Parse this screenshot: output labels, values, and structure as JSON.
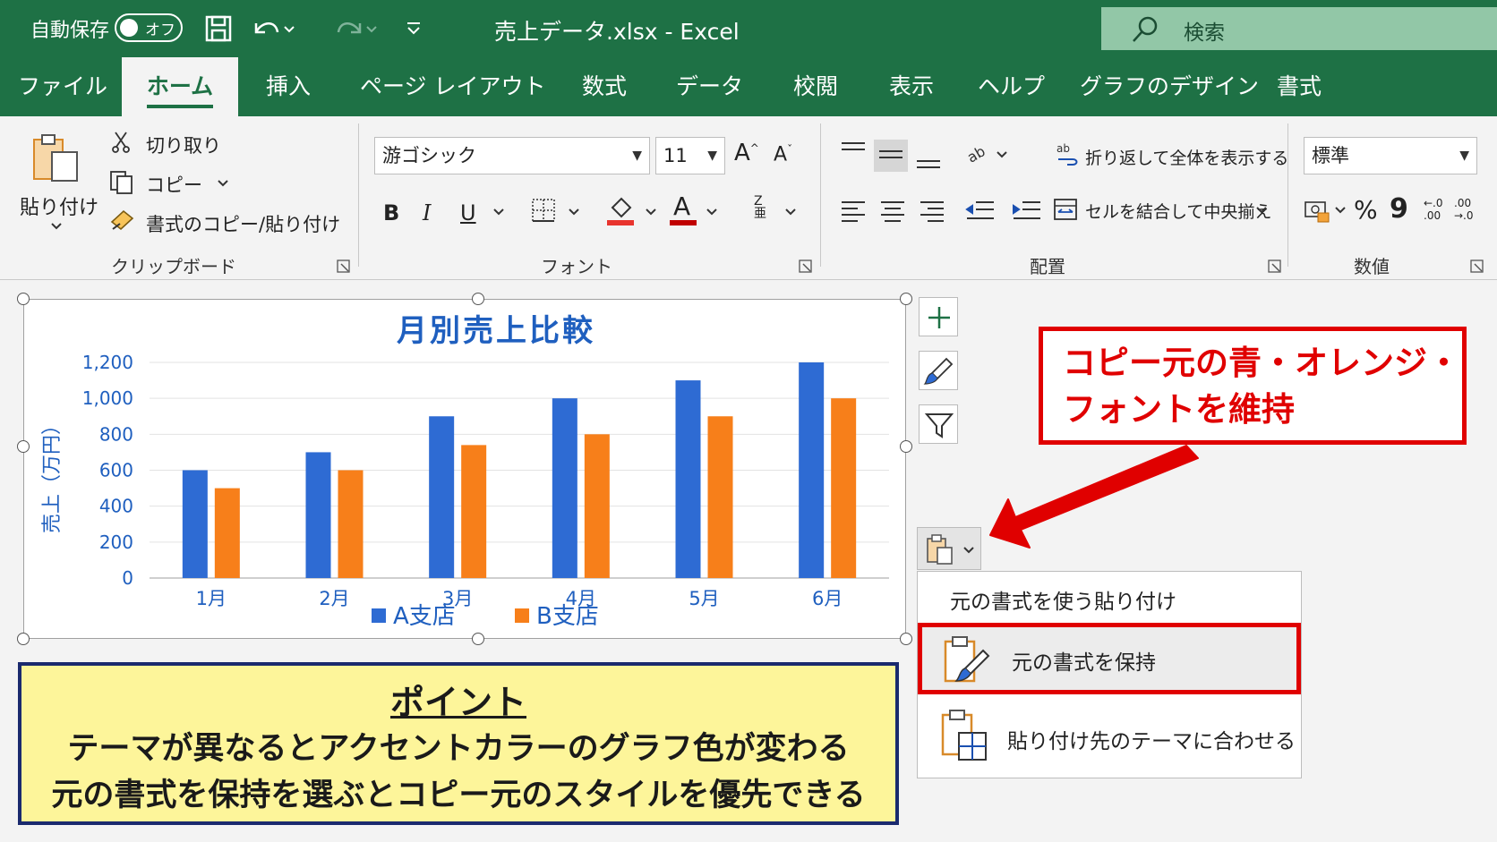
{
  "titlebar": {
    "autosave_label": "自動保存",
    "autosave_state": "オフ",
    "doc_title": "売上データ.xlsx - Excel",
    "search_label": "検索"
  },
  "tabs": [
    "ファイル",
    "ホーム",
    "挿入",
    "ページ レイアウト",
    "数式",
    "データ",
    "校閲",
    "表示",
    "ヘルプ",
    "グラフのデザイン",
    "書式"
  ],
  "active_tab": "ホーム",
  "ribbon": {
    "clipboard": {
      "paste_label": "貼り付け",
      "cut_label": "切り取り",
      "copy_label": "コピー",
      "format_painter_label": "書式のコピー/貼り付け",
      "group_label": "クリップボード"
    },
    "font": {
      "font_name": "游ゴシック",
      "font_size": "11",
      "bold": "B",
      "italic": "I",
      "underline": "U",
      "group_label": "フォント"
    },
    "alignment": {
      "wrap_text_label": "折り返して全体を表示する",
      "merge_center_label": "セルを結合して中央揃え",
      "group_label": "配置"
    },
    "number": {
      "format_value": "標準",
      "percent": "%",
      "comma": "9",
      "group_label": "数値"
    }
  },
  "chart_data": {
    "type": "bar",
    "title": "月別売上比較",
    "xlabel": "",
    "ylabel": "売上（万円）",
    "categories": [
      "1月",
      "2月",
      "3月",
      "4月",
      "5月",
      "6月"
    ],
    "series": [
      {
        "name": "A支店",
        "values": [
          600,
          700,
          900,
          1000,
          1100,
          1200
        ]
      },
      {
        "name": "B支店",
        "values": [
          500,
          600,
          740,
          800,
          900,
          1000
        ]
      }
    ],
    "ylim": [
      0,
      1200
    ],
    "yticks": [
      "0",
      "200",
      "400",
      "600",
      "800",
      "1,000",
      "1,200"
    ],
    "grid": true,
    "legend_position": "bottom",
    "colors": {
      "A支店": "#2e6bd3",
      "B支店": "#f77f1a",
      "title": "#1f5fbf",
      "axis_text": "#1f5fbf"
    }
  },
  "callout": {
    "line1": "コピー元の青・オレンジ・",
    "line2": "フォントを維持"
  },
  "paste_menu": {
    "header": "元の書式を使う貼り付け",
    "options": [
      "元の書式を保持",
      "貼り付け先のテーマに合わせる"
    ]
  },
  "note": {
    "title": "ポイント",
    "line1": "テーマが異なるとアクセントカラーのグラフ色が変わる",
    "line2": "元の書式を保持を選ぶとコピー元のスタイルを優先できる"
  },
  "colors": {
    "excel_green": "#1e7145",
    "highlight_red": "#e00000",
    "note_bg": "#fdf59a",
    "note_border": "#1a2a6e"
  }
}
